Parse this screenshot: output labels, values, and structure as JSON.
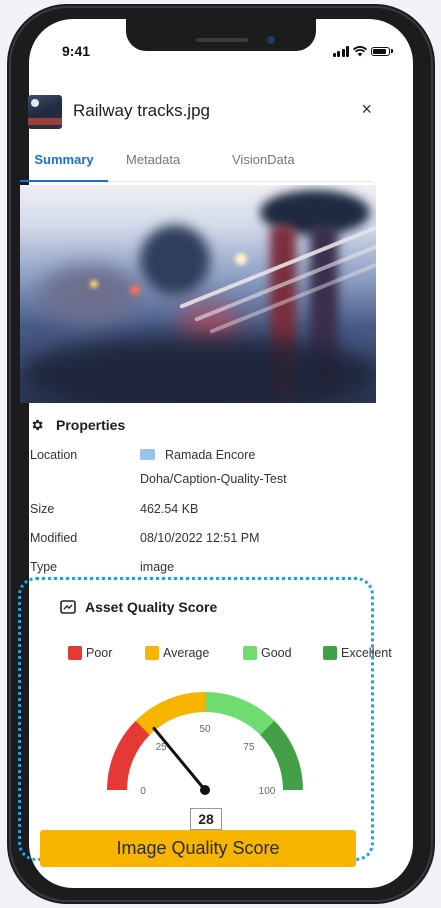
{
  "status_bar": {
    "time": "9:41"
  },
  "file": {
    "title": "Railway tracks.jpg",
    "close_symbol": "×"
  },
  "tabs": [
    {
      "label": "Summary",
      "active": true
    },
    {
      "label": "Metadata",
      "active": false
    },
    {
      "label": "VisionData",
      "active": false
    }
  ],
  "properties": {
    "title": "Properties",
    "rows": [
      {
        "label": "Location",
        "value": "Ramada Encore",
        "value2": "Doha/Caption-Quality-Test"
      },
      {
        "label": "Size",
        "value": "462.54 KB"
      },
      {
        "label": "Modified",
        "value": "08/10/2022 12:51 PM"
      },
      {
        "label": "Type",
        "value": "image"
      }
    ]
  },
  "asset_quality": {
    "title": "Asset Quality Score",
    "legend": [
      {
        "label": "Poor",
        "color": "#e53935"
      },
      {
        "label": "Average",
        "color": "#f7b500"
      },
      {
        "label": "Good",
        "color": "#6fdc6f"
      },
      {
        "label": "Excellent",
        "color": "#43a047"
      }
    ],
    "gauge_ticks": [
      "0",
      "25",
      "50",
      "75",
      "100"
    ],
    "score": 28,
    "score_label": "28"
  },
  "banner": {
    "label": "Image Quality Score"
  },
  "colors": {
    "accent": "#1a6fd6",
    "highlight_border": "#1aa3e8",
    "banner": "#f7b500"
  }
}
